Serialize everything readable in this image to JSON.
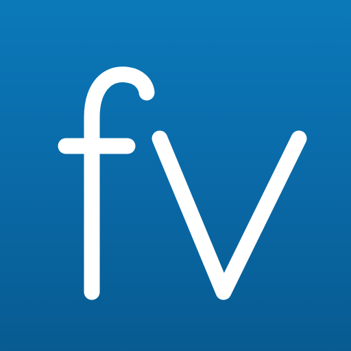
{
  "app_icon": {
    "logo_text": "fv",
    "icon": "fv-logo-icon",
    "colors": {
      "background_top": "#0b79b9",
      "background_middle": "#0a6aa8",
      "background_bottom": "#075b91",
      "logo": "#ffffff"
    }
  }
}
